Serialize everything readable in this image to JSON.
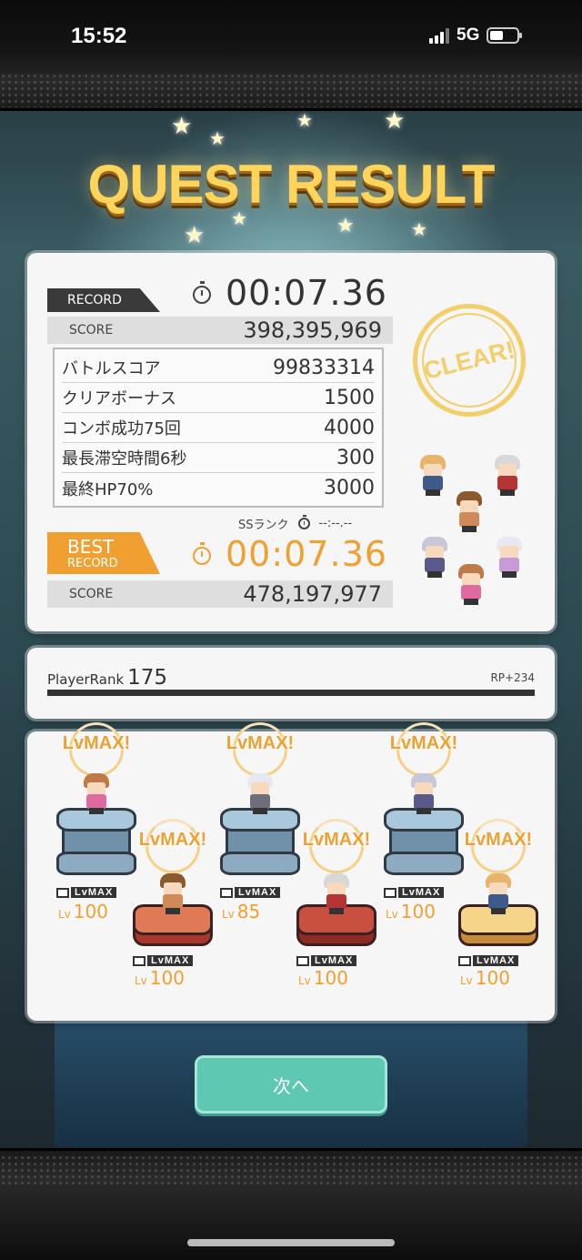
{
  "status_bar": {
    "time": "15:52",
    "network": "5G"
  },
  "title": "QUEST RESULT",
  "record": {
    "tag_label": "RECORD",
    "time": "00:07.36",
    "score_label": "SCORE",
    "score": "398,395,969"
  },
  "breakdown": [
    {
      "label": "バトルスコア",
      "value": "99833314"
    },
    {
      "label": "クリアボーナス",
      "value": "1500"
    },
    {
      "label": "コンボ成功75回",
      "value": "4000"
    },
    {
      "label": "最長滞空時間6秒",
      "value": "300"
    },
    {
      "label": "最終HP70%",
      "value": "3000"
    }
  ],
  "ss_rank": {
    "label": "SSランク",
    "time": "--:--.--"
  },
  "best_record": {
    "tag_line1": "BEST",
    "tag_line2": "RECORD",
    "time": "00:07.36",
    "score_label": "SCORE",
    "score": "478,197,977"
  },
  "clear_stamp": "CLEAR!",
  "player_rank": {
    "label": "PlayerRank",
    "value": "175",
    "rp": "RP+234"
  },
  "units": [
    {
      "lvmax": "LvMAX!",
      "badge": "LvMAX",
      "lv_prefix": "Lv",
      "level": "100"
    },
    {
      "lvmax": "LvMAX!",
      "badge": "LvMAX",
      "lv_prefix": "Lv",
      "level": "100"
    },
    {
      "lvmax": "LvMAX!",
      "badge": "LvMAX",
      "lv_prefix": "Lv",
      "level": "85"
    },
    {
      "lvmax": "LvMAX!",
      "badge": "LvMAX",
      "lv_prefix": "Lv",
      "level": "100"
    },
    {
      "lvmax": "LvMAX!",
      "badge": "LvMAX",
      "lv_prefix": "Lv",
      "level": "100"
    },
    {
      "lvmax": "LvMAX!",
      "badge": "LvMAX",
      "lv_prefix": "Lv",
      "level": "100"
    }
  ],
  "next_button": "次へ",
  "colors": {
    "accent_orange": "#f0a030",
    "button_teal": "#5fc8b3",
    "title_gold": "#ffd45a"
  }
}
